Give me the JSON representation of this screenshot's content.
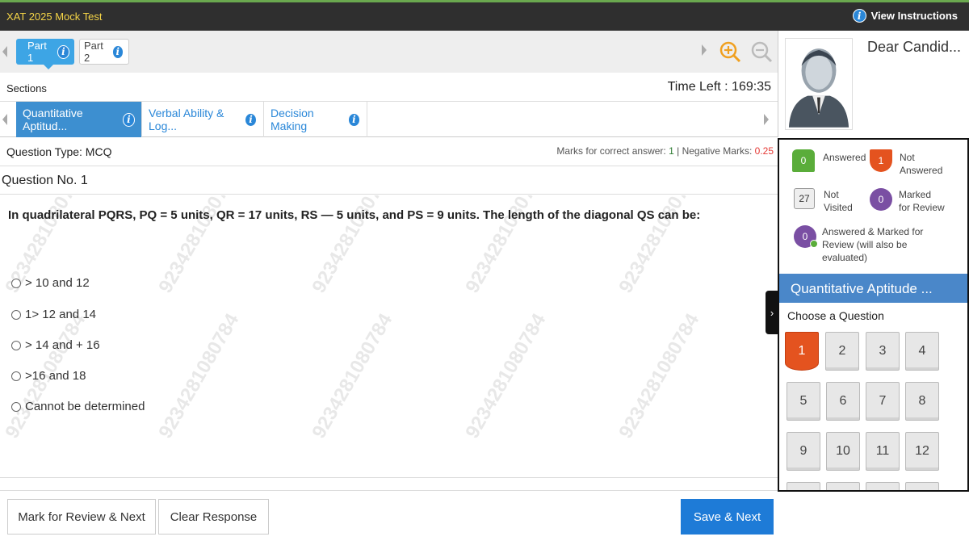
{
  "header": {
    "title": "XAT 2025 Mock Test",
    "instructions": "View Instructions"
  },
  "parts": [
    {
      "label": "Part 1"
    },
    {
      "label": "Part 2"
    }
  ],
  "sections_label": "Sections",
  "time_left": "Time Left : 169:35",
  "section_tabs": [
    {
      "label": "Quantitative Aptitud..."
    },
    {
      "label": "Verbal Ability & Log..."
    },
    {
      "label": "Decision Making"
    }
  ],
  "question_type": "Question Type: MCQ",
  "marks": {
    "correct_label": "Marks for correct answer:",
    "correct": "1",
    "sep": "|",
    "negative_label": "Negative Marks:",
    "negative": "0.25"
  },
  "question_no": "Question No. 1",
  "question_text": "In quadrilateral PQRS, PQ = 5 units, QR = 17 units, RS — 5 units, and PS = 9 units. The length of the diagonal QS can be:",
  "options": [
    "> 10 and 12",
    "1> 12 and 14",
    "> 14 and + 16",
    ">16 and 18",
    "Cannot be determined"
  ],
  "watermark": "9234281080784",
  "buttons": {
    "mark_review": "Mark for Review & Next",
    "clear": "Clear Response",
    "save_next": "Save & Next"
  },
  "profile": {
    "greeting": "Dear Candid..."
  },
  "legend": {
    "answered": {
      "count": "0",
      "label": "Answered",
      "color": "#5aad3a"
    },
    "not_answered": {
      "count": "1",
      "label_1": "Not",
      "label_2": "Answered",
      "color": "#e4531f"
    },
    "not_visited": {
      "count": "27",
      "label_1": "Not",
      "label_2": "Visited"
    },
    "marked": {
      "count": "0",
      "label_1": "Marked",
      "label_2": "for Review",
      "color": "#7a4fa3"
    },
    "answered_marked": {
      "count": "0",
      "label_1": "Answered & Marked for",
      "label_2": "Review (will also be",
      "label_3": "evaluated)"
    }
  },
  "palette": {
    "section": "Quantitative Aptitude ...",
    "choose": "Choose a Question",
    "questions": [
      "1",
      "2",
      "3",
      "4",
      "5",
      "6",
      "7",
      "8",
      "9",
      "10",
      "11",
      "12"
    ]
  }
}
